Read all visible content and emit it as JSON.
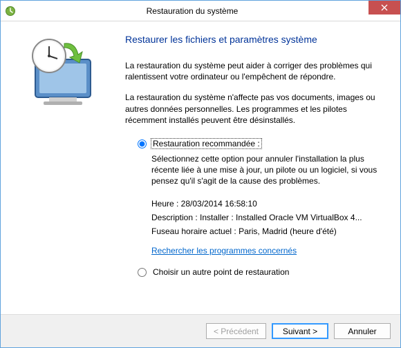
{
  "window": {
    "title": "Restauration du système"
  },
  "heading": "Restaurer les fichiers et paramètres système",
  "paragraphs": {
    "p1": "La restauration du système peut aider à corriger des problèmes qui ralentissent votre ordinateur ou l'empêchent de répondre.",
    "p2": "La restauration du système n'affecte pas vos documents, images ou autres données personnelles. Les programmes et les pilotes récemment installés peuvent être désinstallés."
  },
  "options": {
    "recommended": {
      "label": "Restauration recommandée :",
      "description": "Sélectionnez cette option pour annuler l'installation la plus récente liée à une mise à jour, un pilote ou un logiciel, si vous pensez qu'il s'agit de la cause des problèmes.",
      "time_label": "Heure : 28/03/2014 16:58:10",
      "desc_label": "Description : Installer : Installed Oracle VM VirtualBox 4...",
      "tz_label": "Fuseau horaire actuel : Paris, Madrid (heure d'été)",
      "link": "Rechercher les programmes concernés"
    },
    "other": {
      "label": "Choisir un autre point de restauration"
    }
  },
  "buttons": {
    "back": "< Précédent",
    "next": "Suivant >",
    "cancel": "Annuler"
  }
}
